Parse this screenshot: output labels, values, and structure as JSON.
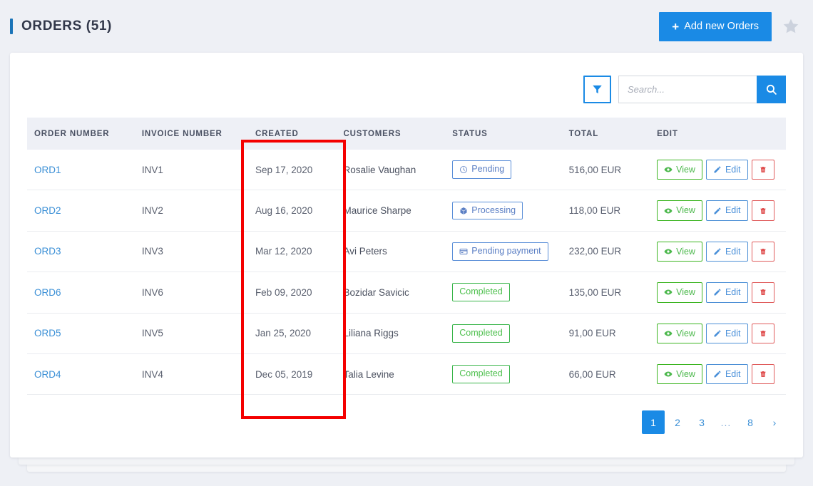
{
  "header": {
    "title": "ORDERS (51)",
    "add_button_label": "Add new Orders",
    "plus_glyph": "+",
    "star_icon": "star-icon"
  },
  "toolbar": {
    "filter_icon": "filter-funnel-icon",
    "search_placeholder": "Search...",
    "search_value": "",
    "search_icon": "search-icon"
  },
  "table": {
    "columns": [
      "ORDER NUMBER",
      "INVOICE NUMBER",
      "CREATED",
      "CUSTOMERS",
      "STATUS",
      "TOTAL",
      "EDIT"
    ],
    "rows": [
      {
        "order_number": "ORD1",
        "invoice_number": "INV1",
        "created": "Sep 17, 2020",
        "customer": "Rosalie Vaughan",
        "status": "Pending",
        "status_type": "blue",
        "status_icon": "clock-icon",
        "total": "516,00 EUR",
        "view_label": "View",
        "edit_label": "Edit"
      },
      {
        "order_number": "ORD2",
        "invoice_number": "INV2",
        "created": "Aug 16, 2020",
        "customer": "Maurice Sharpe",
        "status": "Processing",
        "status_type": "blue",
        "status_icon": "box-icon",
        "total": "118,00 EUR",
        "view_label": "View",
        "edit_label": "Edit"
      },
      {
        "order_number": "ORD3",
        "invoice_number": "INV3",
        "created": "Mar 12, 2020",
        "customer": "Avi Peters",
        "status": "Pending payment",
        "status_type": "blue",
        "status_icon": "card-icon",
        "total": "232,00 EUR",
        "view_label": "View",
        "edit_label": "Edit"
      },
      {
        "order_number": "ORD6",
        "invoice_number": "INV6",
        "created": "Feb 09, 2020",
        "customer": "Bozidar Savicic",
        "status": "Completed",
        "status_type": "green",
        "status_icon": "",
        "total": "135,00 EUR",
        "view_label": "View",
        "edit_label": "Edit"
      },
      {
        "order_number": "ORD5",
        "invoice_number": "INV5",
        "created": "Jan 25, 2020",
        "customer": "Liliana Riggs",
        "status": "Completed",
        "status_type": "green",
        "status_icon": "",
        "total": "91,00 EUR",
        "view_label": "View",
        "edit_label": "Edit"
      },
      {
        "order_number": "ORD4",
        "invoice_number": "INV4",
        "created": "Dec 05, 2019",
        "customer": "Talia Levine",
        "status": "Completed",
        "status_type": "green",
        "status_icon": "",
        "total": "66,00 EUR",
        "view_label": "View",
        "edit_label": "Edit"
      }
    ]
  },
  "pagination": {
    "items": [
      {
        "label": "1",
        "active": true,
        "dots": false
      },
      {
        "label": "2",
        "active": false,
        "dots": false
      },
      {
        "label": "3",
        "active": false,
        "dots": false
      },
      {
        "label": "...",
        "active": false,
        "dots": true
      },
      {
        "label": "8",
        "active": false,
        "dots": false
      },
      {
        "label": "›",
        "active": false,
        "dots": false
      }
    ]
  },
  "annotation": {
    "label": "created-column-highlight",
    "color": "#f40000"
  },
  "colors": {
    "accent_blue": "#1a8ae5",
    "title_accent": "#1a74b8",
    "green": "#3cb521",
    "red": "#e05050",
    "page_bg": "#eef0f5"
  }
}
